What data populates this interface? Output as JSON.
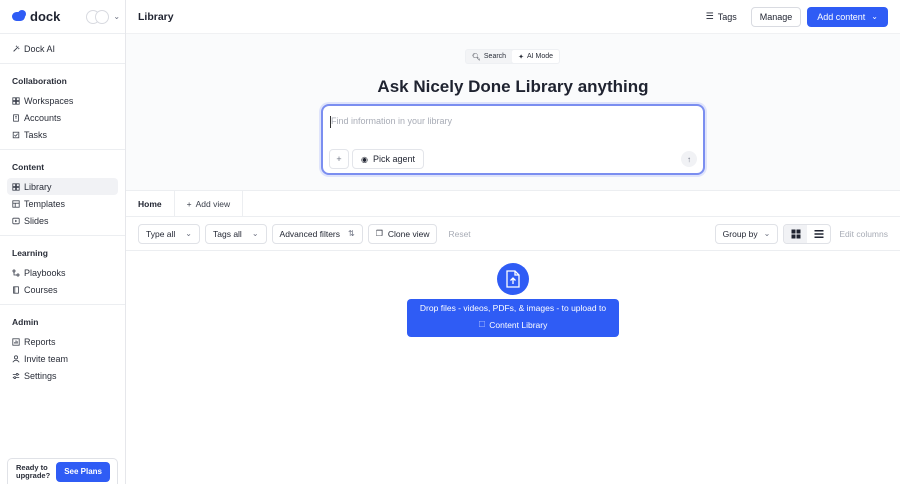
{
  "brand": {
    "name": "dock"
  },
  "sidebar": {
    "top_item": {
      "label": "Dock AI",
      "icon": "sparkle-icon"
    },
    "sections": [
      {
        "heading": "Collaboration",
        "items": [
          {
            "label": "Workspaces",
            "icon": "grid-icon"
          },
          {
            "label": "Accounts",
            "icon": "building-icon"
          },
          {
            "label": "Tasks",
            "icon": "checkbox-icon"
          }
        ]
      },
      {
        "heading": "Content",
        "items": [
          {
            "label": "Library",
            "icon": "grid-icon",
            "active": true
          },
          {
            "label": "Templates",
            "icon": "template-icon"
          },
          {
            "label": "Slides",
            "icon": "slides-icon"
          }
        ]
      },
      {
        "heading": "Learning",
        "items": [
          {
            "label": "Playbooks",
            "icon": "playbook-icon"
          },
          {
            "label": "Courses",
            "icon": "book-icon"
          }
        ]
      },
      {
        "heading": "Admin",
        "items": [
          {
            "label": "Reports",
            "icon": "chart-icon"
          },
          {
            "label": "Invite team",
            "icon": "users-icon"
          },
          {
            "label": "Settings",
            "icon": "sliders-icon"
          }
        ]
      }
    ],
    "upgrade": {
      "text": "Ready to upgrade?",
      "button": "See Plans"
    }
  },
  "header": {
    "title": "Library",
    "tags": "Tags",
    "manage": "Manage",
    "add_content": "Add content"
  },
  "hero": {
    "mode_search": "Search",
    "mode_ai": "AI Mode",
    "title": "Ask Nicely Done Library anything",
    "placeholder": "Find information in your library",
    "pick_agent": "Pick agent"
  },
  "tabs": {
    "home": "Home",
    "add_view": "Add view"
  },
  "filters": {
    "type": "Type all",
    "tags": "Tags all",
    "advanced": "Advanced filters",
    "clone": "Clone view",
    "reset": "Reset",
    "group_by": "Group by",
    "edit_columns": "Edit columns"
  },
  "dropzone": {
    "line1": "Drop files - videos, PDFs, & images - to upload to",
    "line2": "Content Library"
  },
  "colors": {
    "accent": "#2f5cf5"
  }
}
